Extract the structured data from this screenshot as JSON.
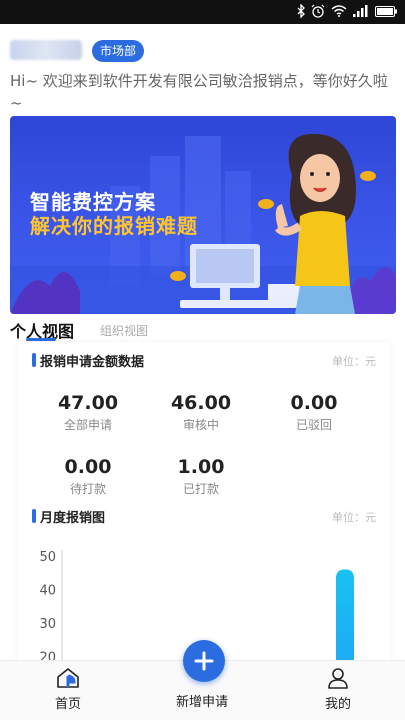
{
  "header": {
    "department": "市场部",
    "greeting": "Hi~ 欢迎来到软件开发有限公司敏洽报销点，等你好久啦~"
  },
  "banner": {
    "line1": "智能费控方案",
    "line2": "解决你的报销难题"
  },
  "tabs": {
    "active": "个人视图",
    "inactive": "组织视图"
  },
  "amount_section": {
    "title": "报销申请金额数据",
    "unit": "单位：元",
    "stats": [
      {
        "value": "47.00",
        "label": "全部申请"
      },
      {
        "value": "46.00",
        "label": "审核中"
      },
      {
        "value": "0.00",
        "label": "已驳回"
      },
      {
        "value": "0.00",
        "label": "待打款"
      },
      {
        "value": "1.00",
        "label": "已打款"
      }
    ]
  },
  "monthly_section": {
    "title": "月度报销图",
    "unit": "单位：元"
  },
  "chart_data": {
    "type": "bar",
    "title": "月度报销图",
    "ylim": [
      20,
      50
    ],
    "yticks": [
      "50",
      "40",
      "30",
      "20"
    ],
    "values": [
      46
    ],
    "bar_color": "#1fbff0"
  },
  "bottom_nav": {
    "home": "首页",
    "new": "新增申请",
    "mine": "我的"
  },
  "colors": {
    "accent": "#2b6de0"
  }
}
